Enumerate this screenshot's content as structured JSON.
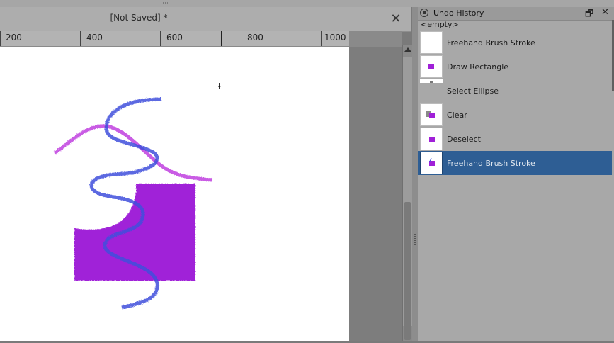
{
  "document": {
    "title": "[Not Saved]  *",
    "close_glyph": "✕"
  },
  "ruler": {
    "labels": [
      "200",
      "400",
      "600",
      "800",
      "1000"
    ]
  },
  "panel": {
    "title": "Undo History",
    "float_glyph": "🗗",
    "close_glyph": "✕",
    "empty_label": "<empty>",
    "items": [
      {
        "label": "Freehand Brush Stroke",
        "selected": false
      },
      {
        "label": "Draw Rectangle",
        "selected": false
      },
      {
        "label": "Select Ellipse",
        "selected": false
      },
      {
        "label": "Clear",
        "selected": false
      },
      {
        "label": "Deselect",
        "selected": false
      },
      {
        "label": "Freehand Brush Stroke",
        "selected": true
      }
    ]
  },
  "colors": {
    "accent": "#2e5e94",
    "purple_fill": "#a020d8",
    "blue_stroke": "#3f4fdc",
    "magenta_stroke": "#c040e0"
  },
  "icons": {
    "panel_icon": "undo-history-icon",
    "cursor": "text-cursor-icon"
  }
}
